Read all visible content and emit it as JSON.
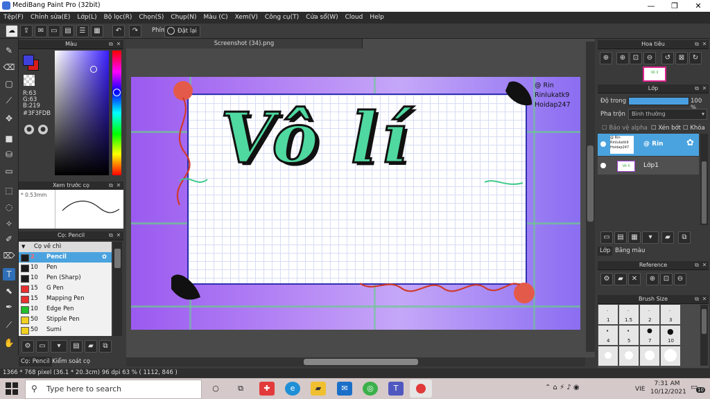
{
  "window": {
    "title": "MediBang Paint Pro (32bit)",
    "min": "—",
    "max": "❐",
    "close": "✕"
  },
  "menu": [
    "Tệp(F)",
    "Chỉnh sửa(E)",
    "Lớp(L)",
    "Bộ lọc(R)",
    "Chọn(S)",
    "Chụp(N)",
    "Màu (C)",
    "Xem(V)",
    "Công cụ(T)",
    "Cửa sổ(W)",
    "Cloud",
    "Help"
  ],
  "toolbar": {
    "phim_label": "Phím",
    "reset_label": "Đặt lại"
  },
  "color_panel": {
    "title": "Màu",
    "r": "R:63",
    "g": "G:63",
    "b": "B:219",
    "hex": "#3F3FDB",
    "primary_color": "#3f3fdb",
    "secondary_color": "#d81b1b"
  },
  "preview_panel": {
    "title": "Xem trước cọ",
    "size": "0.53mm"
  },
  "brush_panel": {
    "title": "Cọ: Pencil",
    "group": "Cọ vẽ chì",
    "items": [
      {
        "size": "2",
        "name": "Pencil",
        "color": "#1b1b1b"
      },
      {
        "size": "10",
        "name": "Pen",
        "color": "#1b1b1b"
      },
      {
        "size": "10",
        "name": "Pen (Sharp)",
        "color": "#1b1b1b"
      },
      {
        "size": "15",
        "name": "G Pen",
        "color": "#e83030"
      },
      {
        "size": "15",
        "name": "Mapping Pen",
        "color": "#e83030"
      },
      {
        "size": "10",
        "name": "Edge Pen",
        "color": "#22c02a"
      },
      {
        "size": "50",
        "name": "Stipple Pen",
        "color": "#f0d020"
      },
      {
        "size": "50",
        "name": "Sumi",
        "color": "#f0d020"
      }
    ],
    "tab_brush": "Cọ: Pencil",
    "tab_control": "Kiểm soát cọ"
  },
  "document": {
    "tab_title": "Screenshot (34).png"
  },
  "artwork": {
    "text": "Vô lí",
    "watermark": [
      "@ Rin",
      "Rinlukatk9",
      "Hoidap247"
    ]
  },
  "navigator": {
    "title": "Hoa tiêu"
  },
  "layer_panel": {
    "title": "Lớp",
    "opacity_label": "Độ trong",
    "opacity_value": "100 %",
    "blend_label": "Pha trộn",
    "blend_value": "Bình thường",
    "protect_alpha": "Bảo vệ alpha",
    "clipping": "Xén bớt",
    "lock": "Khóa",
    "layers": [
      {
        "name": "@ Rin",
        "thumb": "@ Rin Rinlukatk9 Hoidap247"
      },
      {
        "name": "Lớp1",
        "thumb": "Vô lí"
      }
    ],
    "tab_layer": "Lớp",
    "tab_material": "Băng màu"
  },
  "reference_panel": {
    "title": "Reference"
  },
  "brush_size_panel": {
    "title": "Brush Size",
    "sizes": [
      "1",
      "1.5",
      "2",
      "3",
      "4",
      "5",
      "7",
      "10"
    ]
  },
  "status": {
    "text": "1366 * 768 pixel   (36.1 * 20.3cm)   96 dpi   63 %   ( 1112, 846 )"
  },
  "taskbar": {
    "search_placeholder": "Type here to search",
    "time": "7:31 AM",
    "date": "10/12/2021",
    "lang": "VIE",
    "notif_count": "10"
  }
}
